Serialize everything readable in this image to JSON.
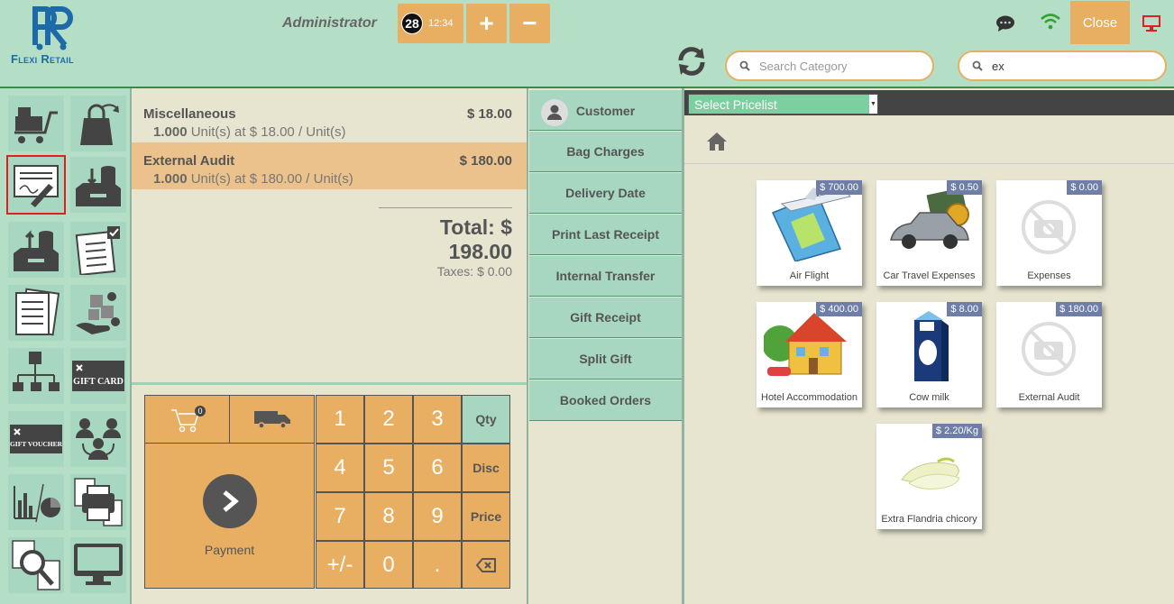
{
  "header": {
    "logo_text": "Flexi Retail",
    "user": "Administrator",
    "order_number": "28",
    "order_time": "12:34",
    "add_order": "+",
    "remove_order": "−",
    "search_category_placeholder": "Search Category",
    "search_product_value": "ex",
    "close_label": "Close"
  },
  "order": {
    "lines": [
      {
        "name": "Miscellaneous",
        "price": "$ 18.00",
        "qty": "1.000",
        "detail": "Unit(s) at $ 18.00 / Unit(s)",
        "selected": false
      },
      {
        "name": "External Audit",
        "price": "$ 180.00",
        "qty": "1.000",
        "detail": "Unit(s) at $ 180.00 / Unit(s)",
        "selected": true
      }
    ],
    "total": "Total: $ 198.00",
    "taxes": "Taxes: $ 0.00"
  },
  "numpad": {
    "cart_count": "0",
    "keys": [
      "1",
      "2",
      "3",
      "4",
      "5",
      "6",
      "7",
      "8",
      "9",
      "+/-",
      "0",
      "."
    ],
    "modes": [
      "Qty",
      "Disc",
      "Price"
    ],
    "active_mode": "Qty",
    "payment_label": "Payment"
  },
  "actions": [
    "Customer",
    "Bag Charges",
    "Delivery Date",
    "Print Last Receipt",
    "Internal Transfer",
    "Gift Receipt",
    "Split Gift",
    "Booked Orders"
  ],
  "pricelist": {
    "selected": "Select Pricelist"
  },
  "products": [
    {
      "name": "Air Flight",
      "price": "$ 700.00",
      "image": "air-flight"
    },
    {
      "name": "Car Travel Expenses",
      "price": "$ 0.50",
      "image": "car"
    },
    {
      "name": "Expenses",
      "price": "$ 0.00",
      "image": "no-photo"
    },
    {
      "name": "Hotel Accommodation",
      "price": "$ 400.00",
      "image": "house"
    },
    {
      "name": "Cow milk",
      "price": "$ 8.00",
      "image": "milk-carton"
    },
    {
      "name": "External Audit",
      "price": "$ 180.00",
      "image": "no-photo"
    },
    {
      "name": "Extra Flandria chicory",
      "price": "$ 2.20/Kg",
      "image": "chicory"
    }
  ],
  "left_buttons": [
    "cart-transfer",
    "bag-out",
    "order-sign",
    "box-in",
    "box-out",
    "checklist",
    "documents",
    "hand-boxes",
    "hierarchy",
    "gift-card",
    "gift-voucher",
    "users-exchange",
    "reports-chart",
    "print-docs",
    "search-docs",
    "monitor"
  ],
  "colors": {
    "accent": "#e8af62",
    "mint": "#b5dec6",
    "panel": "#e7e4cf",
    "tag": "#6e7ea6"
  }
}
